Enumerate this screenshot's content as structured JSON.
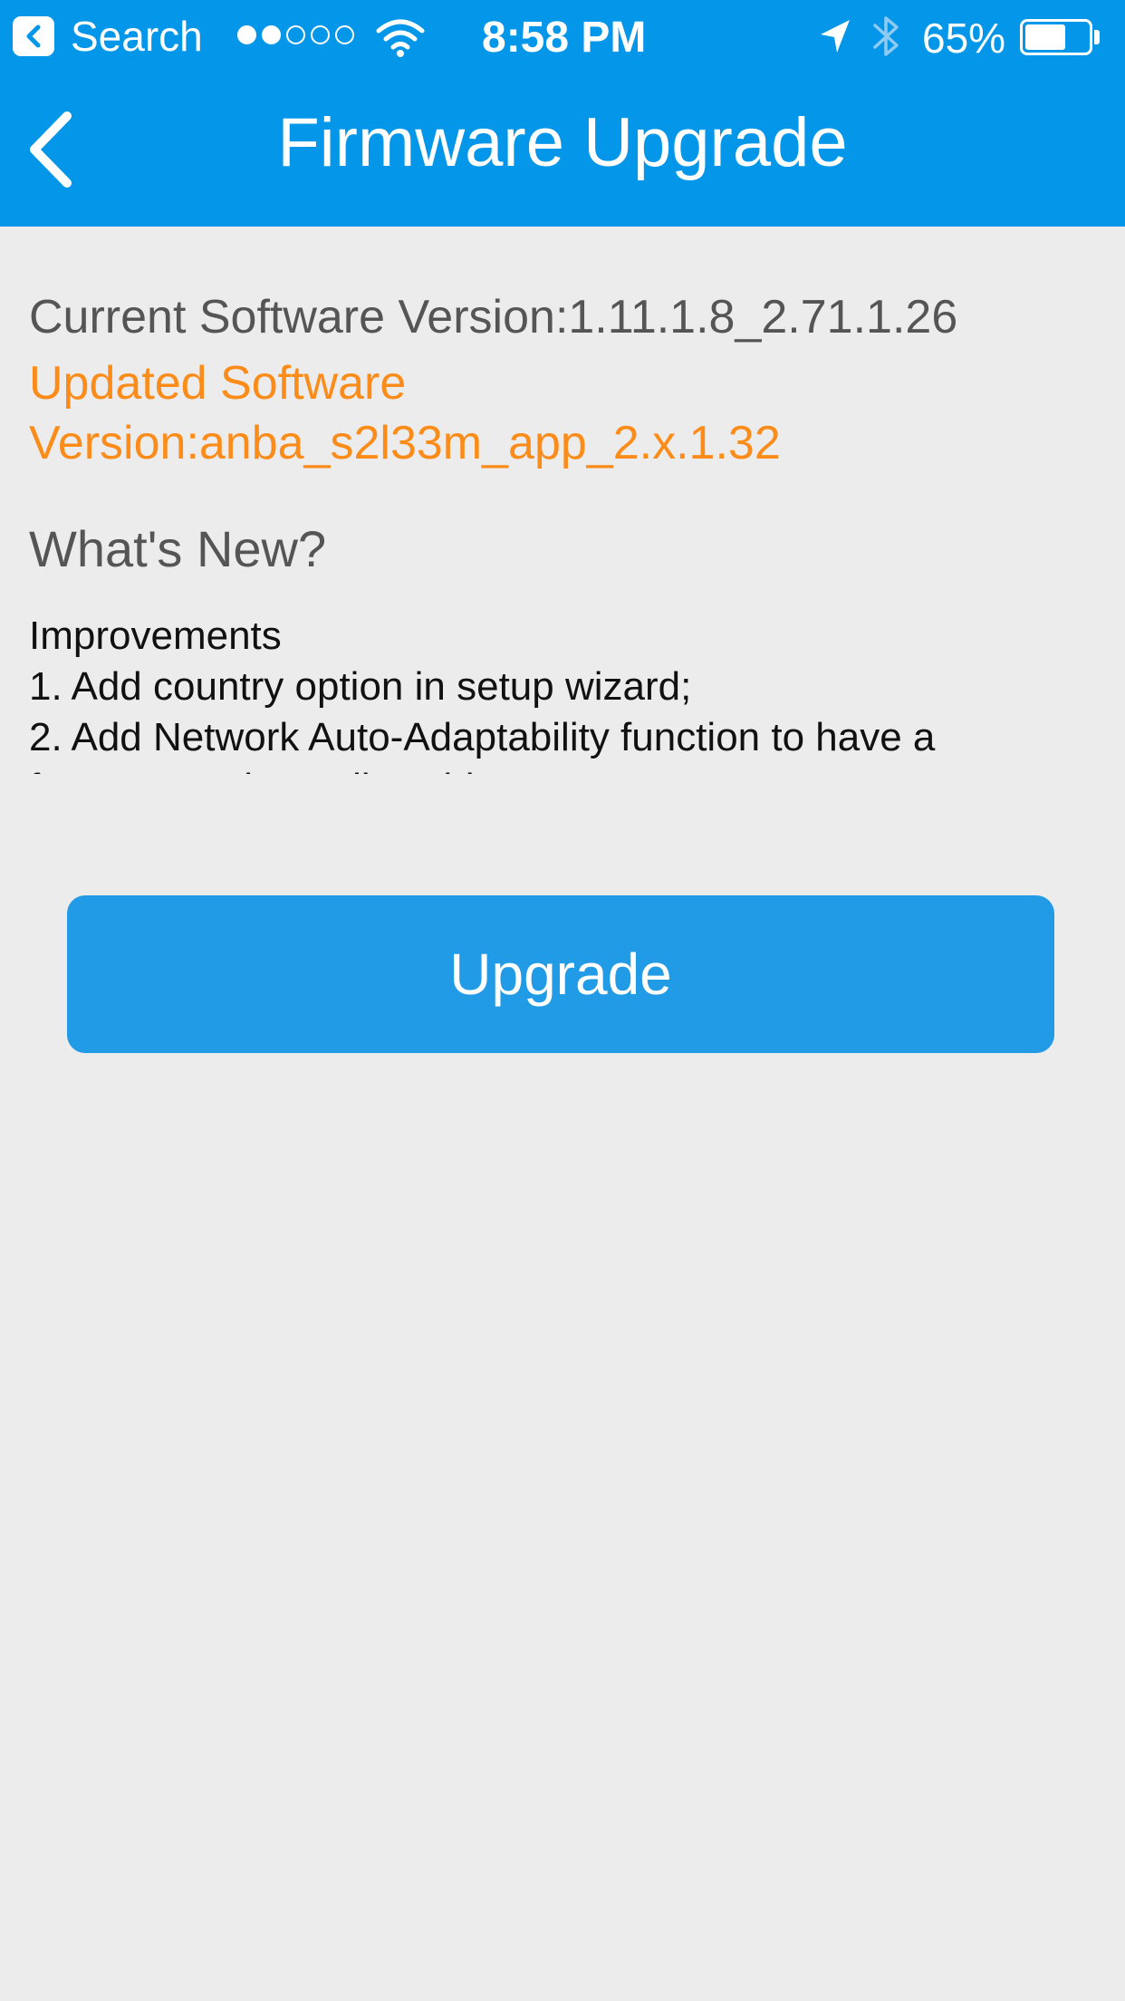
{
  "status_bar": {
    "back_app_label": "Search",
    "signal_dots": [
      true,
      true,
      false,
      false,
      false
    ],
    "time": "8:58 PM",
    "battery_percent": "65%",
    "battery_level": 0.65
  },
  "nav": {
    "title": "Firmware Upgrade",
    "back_icon": "chevron-left-icon"
  },
  "firmware": {
    "current_version": "Current Software Version:1.11.1.8_2.71.1.26",
    "updated_version": "Updated Software Version:anba_s2l33m_app_2.x.1.32",
    "whats_new_heading": "What's New?",
    "notes": [
      "Improvements",
      "1. Add country option in setup wizard;",
      "2. Add Network Auto-Adaptability function to have a",
      "fast connecting to live video;"
    ]
  },
  "actions": {
    "upgrade_label": "Upgrade"
  },
  "colors": {
    "header": "#0496e8",
    "accent_orange": "#fb8c1a",
    "button": "#229be6",
    "background": "#ececec"
  }
}
